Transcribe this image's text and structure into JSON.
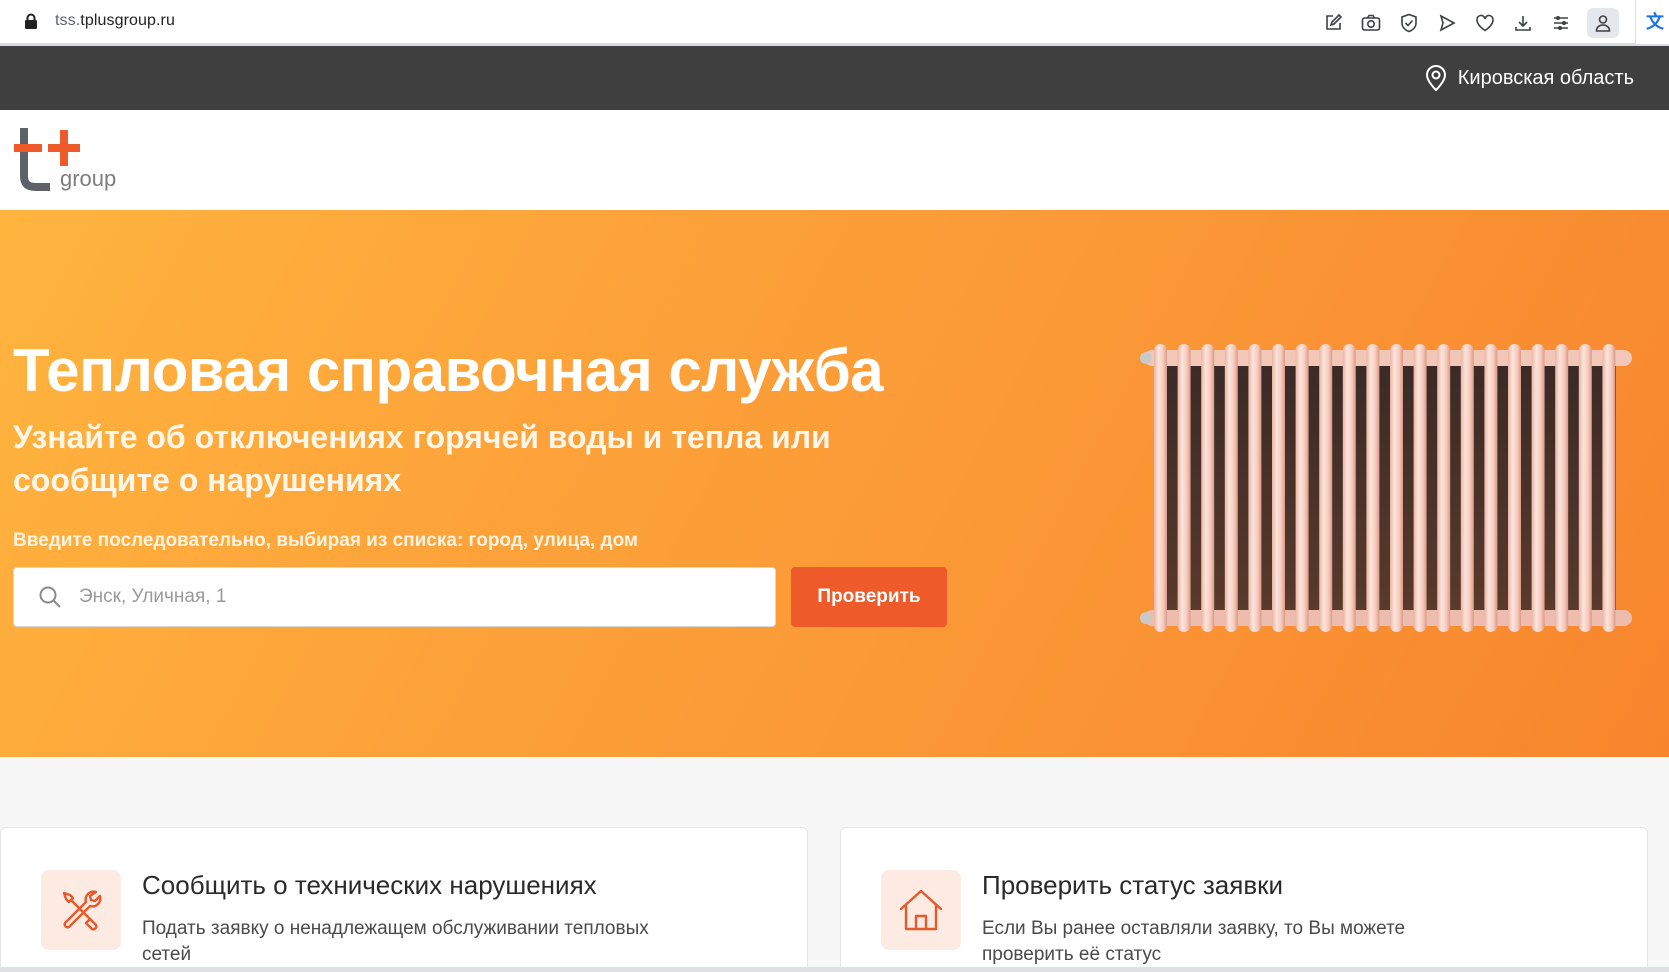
{
  "browser": {
    "url_host_dim": "tss.",
    "url_host_main": "tplusgroup.ru",
    "extension_glyph": "文"
  },
  "region": {
    "label": "Кировская область"
  },
  "logo": {
    "text": "group"
  },
  "hero": {
    "title": "Тепловая справочная служба",
    "subtitle": "Узнайте об отключениях горячей воды и тепла или сообщите о нарушениях",
    "hint": "Введите последовательно, выбирая из списка: город, улица, дом",
    "search_placeholder": "Энск, Уличная, 1",
    "search_value": "",
    "button_label": "Проверить"
  },
  "cards": [
    {
      "title": "Сообщить о технических нарушениях",
      "description": "Подать заявку о ненадлежащем обслуживании тепловых сетей",
      "icon": "tools-icon"
    },
    {
      "title": "Проверить статус заявки",
      "description": "Если Вы ранее оставляли заявку, то Вы можете проверить её статус",
      "icon": "house-icon"
    }
  ],
  "colors": {
    "accent": "#ee5a2a",
    "hero_gradient_start": "#ffb43e",
    "hero_gradient_end": "#f8852d",
    "region_bar": "#3f3f3f"
  }
}
